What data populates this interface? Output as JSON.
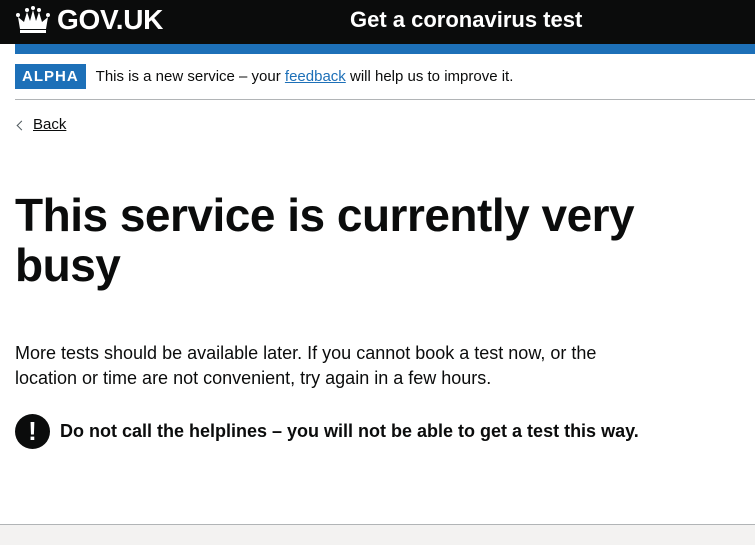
{
  "header": {
    "logo_text": "GOV.UK",
    "service_name": "Get a coronavirus test"
  },
  "phase_banner": {
    "tag": "ALPHA",
    "text_before": "This is a new service – your ",
    "link_text": "feedback",
    "text_after": " will help us to improve it."
  },
  "back_link": {
    "label": "Back"
  },
  "main": {
    "title": "This service is currently very busy",
    "paragraph": "More tests should be available later. If you cannot book a test now, or the location or time are not convenient, try again in a few hours.",
    "warning": {
      "icon": "!",
      "text": "Do not call the helplines – you will not be able to get a test this way."
    }
  },
  "colors": {
    "header_bg": "#0b0c0c",
    "brand_blue": "#1d70b8",
    "text": "#0b0c0c",
    "footer_bg": "#f3f2f1"
  }
}
